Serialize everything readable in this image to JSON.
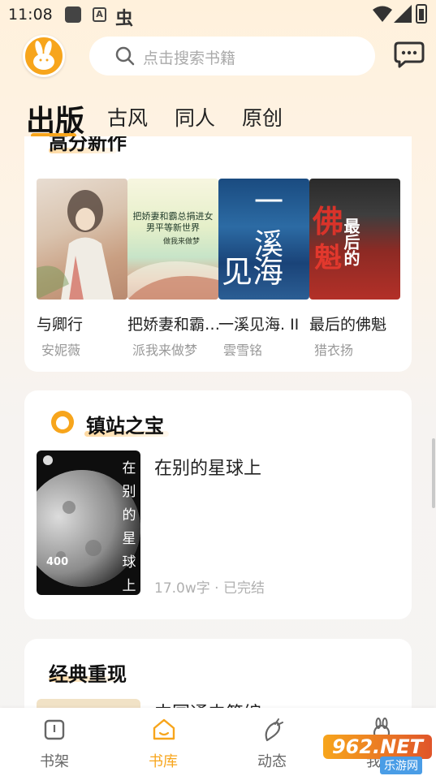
{
  "status_bar": {
    "time": "11:08",
    "notif_a": "A",
    "notif_bug": "虫"
  },
  "header": {
    "search_placeholder": "点击搜索书籍"
  },
  "tabs": [
    {
      "label": "出版",
      "active": true
    },
    {
      "label": "古风",
      "active": false
    },
    {
      "label": "同人",
      "active": false
    },
    {
      "label": "原创",
      "active": false
    }
  ],
  "section_new": {
    "title": "高分新作",
    "books": [
      {
        "title": "与卿行",
        "author": "安妮薇"
      },
      {
        "title": "把娇妻和霸…",
        "author": "派我来做梦",
        "cover_text": "把娇妻和霸总捐进女男平等新世界",
        "cover_sub": "做我来做梦"
      },
      {
        "title": "一溪见海. II",
        "author": "雲雪铭",
        "cover_text_1": "一溪",
        "cover_text_2": "见海"
      },
      {
        "title": "最后的佛魁",
        "author": "猎衣扬",
        "cover_text_1": "佛",
        "cover_text_2": "最后的",
        "cover_text_3": "魁"
      }
    ]
  },
  "section_treasure": {
    "title": "镇站之宝",
    "book": {
      "title": "在别的星球上",
      "meta": "17.0w字 · 已完结",
      "cover_vertical": [
        "在",
        "别",
        "的",
        "星",
        "球",
        "上"
      ],
      "cover_number": "400"
    }
  },
  "section_classic": {
    "title": "经典重现",
    "book_title": "中国通史简编"
  },
  "bottom_nav": [
    {
      "label": "书架",
      "icon": "bookshelf-icon",
      "active": false
    },
    {
      "label": "书库",
      "icon": "library-icon",
      "active": true
    },
    {
      "label": "动态",
      "icon": "feed-icon",
      "active": false
    },
    {
      "label": "我的",
      "icon": "profile-icon",
      "active": false
    }
  ],
  "watermark": {
    "logo": "962.NET",
    "text": "乐游网"
  },
  "colors": {
    "accent": "#f7a51c",
    "text": "#222222",
    "muted": "#999999"
  }
}
